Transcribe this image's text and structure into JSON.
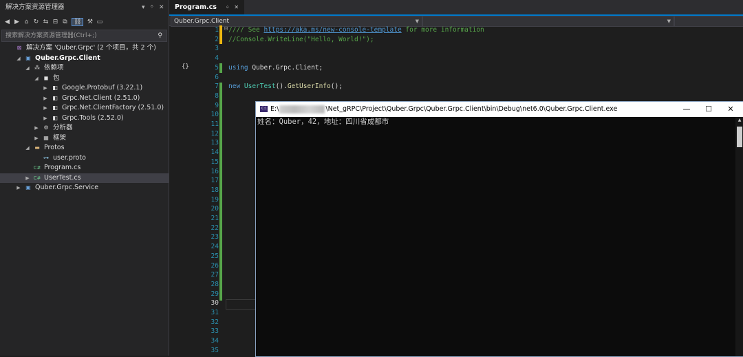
{
  "solution_explorer": {
    "title": "解决方案资源管理器",
    "title_controls": {
      "dropdown": "▾",
      "pin": "ᛜ",
      "close": "✕"
    },
    "toolbar_icons": [
      "back-icon",
      "forward-icon",
      "home-icon",
      "history-icon",
      "sync-icon",
      "collapse-icon",
      "show-all-icon",
      "view-toggle-icon",
      "properties-icon",
      "preview-icon"
    ],
    "search_placeholder": "搜索解决方案资源管理器(Ctrl+;)",
    "tree": [
      {
        "label": "解决方案 'Quber.Grpc' (2 个项目，共 2 个)",
        "icon": "solution-icon",
        "indent": 0,
        "arrow": ""
      },
      {
        "label": "Quber.Grpc.Client",
        "icon": "csharp-project-icon",
        "indent": 1,
        "arrow": "◢",
        "bold": true
      },
      {
        "label": "依赖项",
        "icon": "dependencies-icon",
        "indent": 2,
        "arrow": "◢"
      },
      {
        "label": "包",
        "icon": "package-icon",
        "indent": 3,
        "arrow": "◢"
      },
      {
        "label": "Google.Protobuf (3.22.1)",
        "icon": "nuget-icon",
        "indent": 4,
        "arrow": "▶"
      },
      {
        "label": "Grpc.Net.Client (2.51.0)",
        "icon": "nuget-icon",
        "indent": 4,
        "arrow": "▶"
      },
      {
        "label": "Grpc.Net.ClientFactory (2.51.0)",
        "icon": "nuget-icon",
        "indent": 4,
        "arrow": "▶"
      },
      {
        "label": "Grpc.Tools (2.52.0)",
        "icon": "nuget-icon",
        "indent": 4,
        "arrow": "▶"
      },
      {
        "label": "分析器",
        "icon": "analyzer-icon",
        "indent": 3,
        "arrow": "▶"
      },
      {
        "label": "框架",
        "icon": "framework-icon",
        "indent": 3,
        "arrow": "▶"
      },
      {
        "label": "Protos",
        "icon": "folder-icon",
        "indent": 2,
        "arrow": "◢"
      },
      {
        "label": "user.proto",
        "icon": "proto-file-icon",
        "indent": 3,
        "arrow": ""
      },
      {
        "label": "Program.cs",
        "icon": "csharp-file-icon",
        "indent": 2,
        "arrow": ""
      },
      {
        "label": "UserTest.cs",
        "icon": "csharp-file-icon",
        "indent": 2,
        "arrow": "▶",
        "selected": true
      },
      {
        "label": "Quber.Grpc.Service",
        "icon": "csharp-project-icon",
        "indent": 1,
        "arrow": "▶"
      }
    ]
  },
  "editor": {
    "tab": {
      "label": "Program.cs",
      "pin": "ᛜ",
      "close": "✕"
    },
    "nav_project": "Quber.Grpc.Client",
    "code_lines": [
      {
        "n": "1",
        "parts": [
          [
            "cm",
            "//// See "
          ],
          [
            "lk",
            "https://aka.ms/new-console-template"
          ],
          [
            "cm",
            " for more information"
          ]
        ]
      },
      {
        "n": "2",
        "parts": [
          [
            "cm",
            "//Console.WriteLine(\"Hello, World!\");"
          ]
        ]
      },
      {
        "n": "3",
        "parts": []
      },
      {
        "n": "4",
        "parts": []
      },
      {
        "n": "5",
        "parts": [
          [
            "kw",
            "using "
          ],
          [
            "tx",
            "Quber.Grpc.Client;"
          ]
        ]
      },
      {
        "n": "6",
        "parts": []
      },
      {
        "n": "7",
        "parts": [
          [
            "kw",
            "new "
          ],
          [
            "ty",
            "UserTest"
          ],
          [
            "tx",
            "()."
          ],
          [
            "mt",
            "GetUserInfo"
          ],
          [
            "tx",
            "();"
          ]
        ]
      },
      {
        "n": "8",
        "parts": []
      },
      {
        "n": "9",
        "parts": []
      },
      {
        "n": "10",
        "parts": []
      },
      {
        "n": "11",
        "parts": []
      },
      {
        "n": "12",
        "parts": []
      },
      {
        "n": "13",
        "parts": []
      },
      {
        "n": "14",
        "parts": []
      },
      {
        "n": "15",
        "parts": []
      },
      {
        "n": "16",
        "parts": []
      },
      {
        "n": "17",
        "parts": []
      },
      {
        "n": "18",
        "parts": []
      },
      {
        "n": "19",
        "parts": []
      },
      {
        "n": "20",
        "parts": []
      },
      {
        "n": "21",
        "parts": []
      },
      {
        "n": "22",
        "parts": []
      },
      {
        "n": "23",
        "parts": []
      },
      {
        "n": "24",
        "parts": []
      },
      {
        "n": "25",
        "parts": []
      },
      {
        "n": "26",
        "parts": []
      },
      {
        "n": "27",
        "parts": []
      },
      {
        "n": "28",
        "parts": []
      },
      {
        "n": "29",
        "parts": []
      },
      {
        "n": "30",
        "parts": []
      },
      {
        "n": "31",
        "parts": []
      },
      {
        "n": "32",
        "parts": []
      },
      {
        "n": "33",
        "parts": []
      },
      {
        "n": "34",
        "parts": []
      },
      {
        "n": "35",
        "parts": []
      }
    ],
    "current_line": "30",
    "brace_indicator": "{}"
  },
  "console": {
    "title_prefix": "E:\\",
    "title_suffix": "\\Net_gRPC\\Project\\Quber.Grpc\\Quber.Grpc.Client\\bin\\Debug\\net6.0\\Quber.Grpc.Client.exe",
    "icon_text": "C:\\",
    "output": "姓名：Quber，42，地址：四川省成都市",
    "controls": {
      "minimize": "—",
      "maximize": "☐",
      "close": "✕"
    }
  },
  "colors": {
    "accent": "#007acc",
    "comment": "#57a64a",
    "keyword": "#569cd6",
    "type": "#4ec9b0",
    "method": "#dcdcaa"
  }
}
